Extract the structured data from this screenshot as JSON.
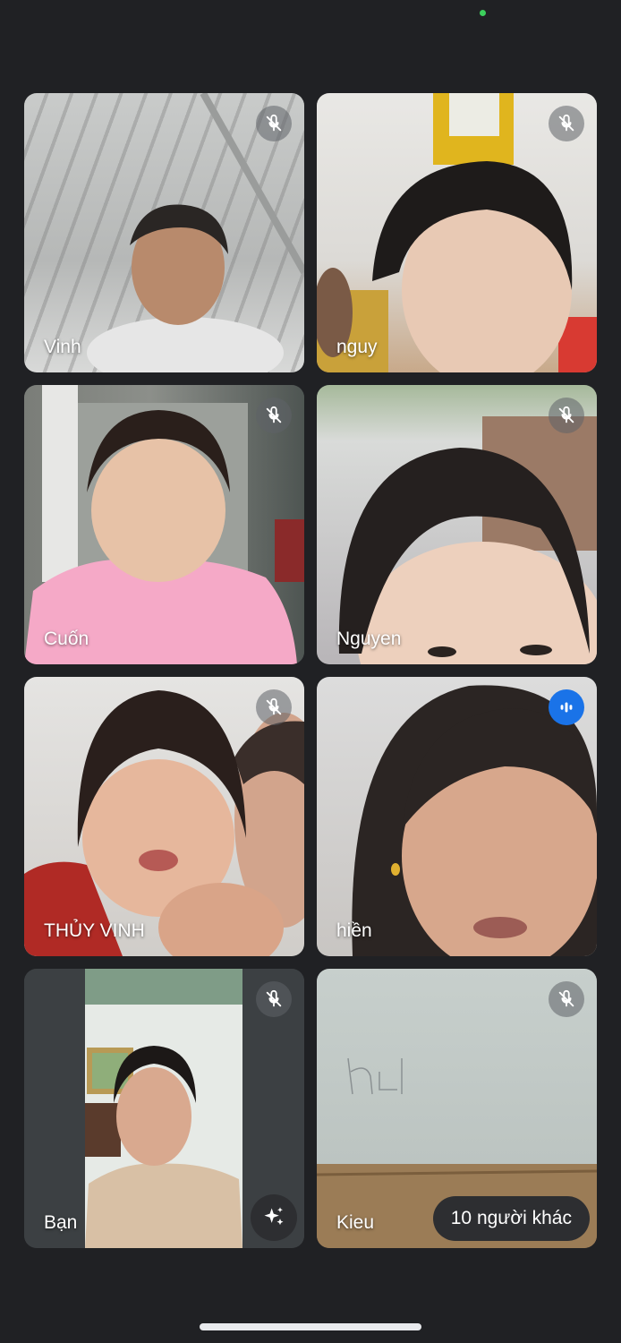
{
  "call": {
    "participants": [
      {
        "name": "Vinh",
        "status": "muted"
      },
      {
        "name": "nguy",
        "status": "muted"
      },
      {
        "name": "Cuốn",
        "status": "muted"
      },
      {
        "name": "Nguyen",
        "status": "muted"
      },
      {
        "name": "THỦY VINH",
        "status": "muted"
      },
      {
        "name": "hiền",
        "status": "speaking"
      },
      {
        "name": "Bạn",
        "status": "muted"
      },
      {
        "name": "Kieu",
        "status": "muted"
      }
    ],
    "others_label": "10 người khác"
  },
  "icons": {
    "mute": "mic-off-icon",
    "speaking": "audio-level-icon",
    "effects": "sparkle-effects-icon"
  },
  "colors": {
    "background": "#202124",
    "speaking_accent": "#1a73e8",
    "camera_indicator": "#3ccf5c"
  }
}
